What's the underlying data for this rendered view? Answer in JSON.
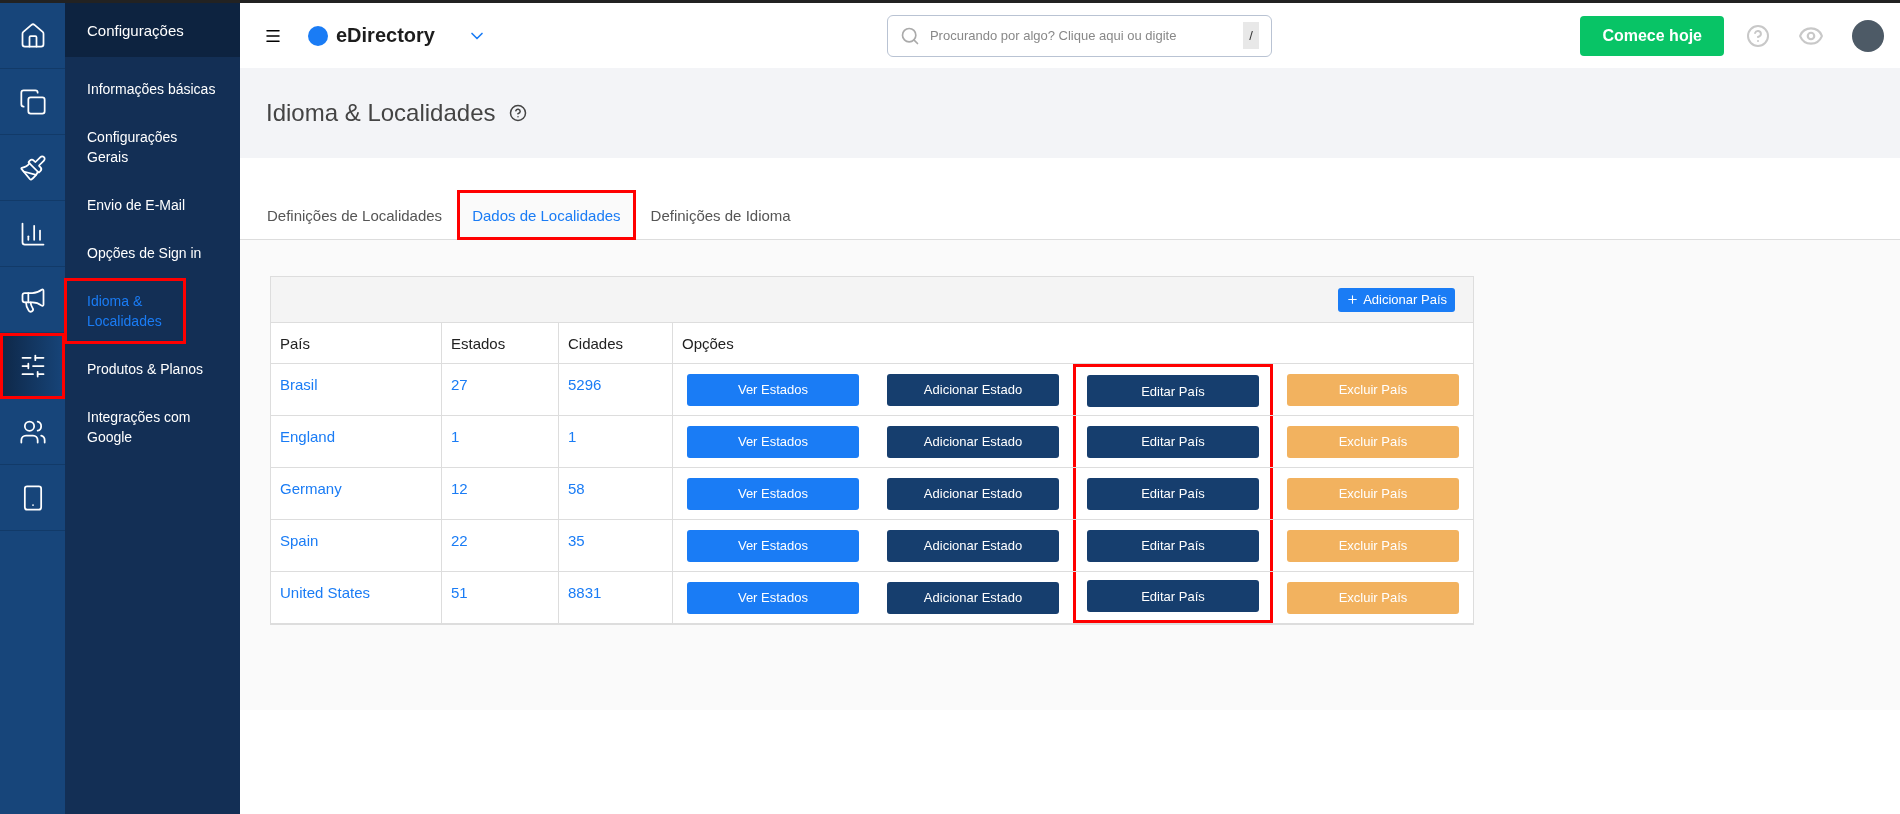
{
  "rail": [
    {
      "kind": "home",
      "selected": false,
      "highlighted": false
    },
    {
      "kind": "pages",
      "selected": false,
      "highlighted": false
    },
    {
      "kind": "brush",
      "selected": false,
      "highlighted": false
    },
    {
      "kind": "chart",
      "selected": false,
      "highlighted": false
    },
    {
      "kind": "megaphone",
      "selected": false,
      "highlighted": false
    },
    {
      "kind": "sliders",
      "selected": true,
      "highlighted": true
    },
    {
      "kind": "users",
      "selected": false,
      "highlighted": false
    },
    {
      "kind": "mobile",
      "selected": false,
      "highlighted": false
    }
  ],
  "sidebar": {
    "title": "Configurações",
    "items": [
      {
        "label": "Informações básicas",
        "selected": false,
        "highlighted": false
      },
      {
        "label": "Configurações Gerais",
        "selected": false,
        "highlighted": false
      },
      {
        "label": "Envio de E-Mail",
        "selected": false,
        "highlighted": false
      },
      {
        "label": "Opções de Sign in",
        "selected": false,
        "highlighted": false
      },
      {
        "label": "Idioma & Localidades",
        "selected": true,
        "highlighted": true
      },
      {
        "label": "Produtos & Planos",
        "selected": false,
        "highlighted": false
      },
      {
        "label": "Integrações com Google",
        "selected": false,
        "highlighted": false
      }
    ]
  },
  "topbar": {
    "brand": "eDirectory",
    "search": {
      "placeholder": "Procurando por algo? Clique aqui ou digite",
      "shortcut": "/"
    },
    "cta": "Comece hoje"
  },
  "page": {
    "title": "Idioma & Localidades"
  },
  "tabs": [
    {
      "label": "Definições de Localidades",
      "selected": false,
      "highlighted": false
    },
    {
      "label": "Dados de Localidades",
      "selected": true,
      "highlighted": true
    },
    {
      "label": "Definições de Idioma",
      "selected": false,
      "highlighted": false
    }
  ],
  "table": {
    "add_button": "Adicionar País",
    "columns": [
      "País",
      "Estados",
      "Cidades",
      "Opções"
    ],
    "option_styles": [
      {
        "kind": "primary",
        "highlighted": false
      },
      {
        "kind": "dark",
        "highlighted": false
      },
      {
        "kind": "dark",
        "highlighted": true
      },
      {
        "kind": "warning",
        "highlighted": false
      }
    ],
    "rows": [
      {
        "country": "Brasil",
        "states": "27",
        "cities": "5296",
        "options": [
          "Ver Estados",
          "Adicionar Estado",
          "Editar País",
          "Excluir País"
        ]
      },
      {
        "country": "England",
        "states": "1",
        "cities": "1",
        "options": [
          "Ver Estados",
          "Adicionar Estado",
          "Editar País",
          "Excluir País"
        ]
      },
      {
        "country": "Germany",
        "states": "12",
        "cities": "58",
        "options": [
          "Ver Estados",
          "Adicionar Estado",
          "Editar País",
          "Excluir País"
        ]
      },
      {
        "country": "Spain",
        "states": "22",
        "cities": "35",
        "options": [
          "Ver Estados",
          "Adicionar Estado",
          "Editar País",
          "Excluir País"
        ]
      },
      {
        "country": "United States",
        "states": "51",
        "cities": "8831",
        "options": [
          "Ver Estados",
          "Adicionar Estado",
          "Editar País",
          "Excluir País"
        ]
      }
    ]
  }
}
